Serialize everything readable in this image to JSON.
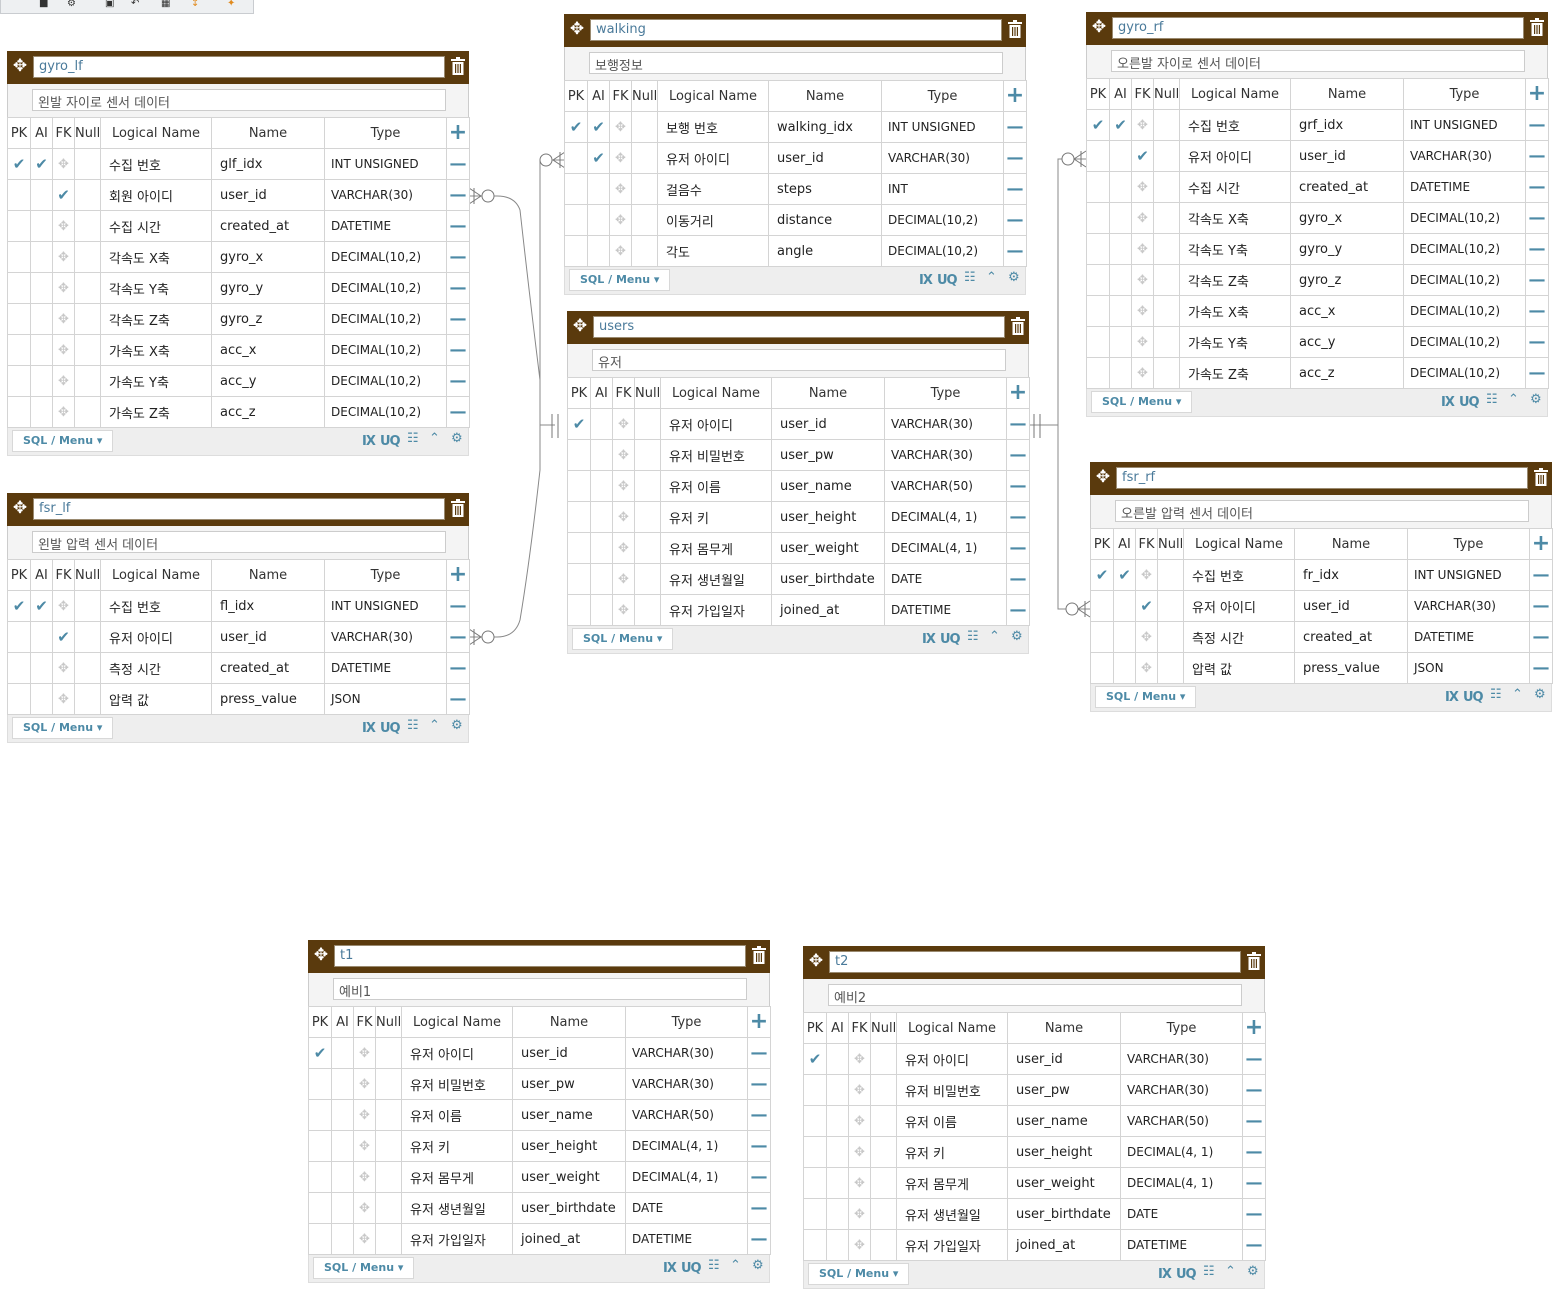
{
  "toolbar": {
    "icons": [
      "save-icon",
      "settings-icon",
      "export-icon",
      "undo-icon",
      "grid-icon",
      "sort-icon",
      "magic-icon"
    ]
  },
  "colors": {
    "header": "#5a3a0d",
    "accent": "#4d8aa6",
    "grid": "#d4d4d4"
  },
  "columns_header": {
    "pk": "PK",
    "ai": "AI",
    "fk": "FK",
    "null": "Null",
    "logical": "Logical Name",
    "name": "Name",
    "type": "Type"
  },
  "footer": {
    "sql_menu": "SQL / Menu",
    "ix": "IX",
    "uq": "UQ"
  },
  "tables": [
    {
      "id": "gyro_lf",
      "name": "gyro_lf",
      "comment": "왼발 자이로 센서 데이터",
      "rows": [
        {
          "pk": true,
          "ai": true,
          "fk": false,
          "logical": "수집 번호",
          "name": "glf_idx",
          "type": "INT UNSIGNED"
        },
        {
          "pk": false,
          "ai": false,
          "fk": true,
          "logical": "회원 아이디",
          "name": "user_id",
          "type": "VARCHAR(30)"
        },
        {
          "pk": false,
          "ai": false,
          "fk": false,
          "logical": "수집 시간",
          "name": "created_at",
          "type": "DATETIME"
        },
        {
          "pk": false,
          "ai": false,
          "fk": false,
          "logical": "각속도 X축",
          "name": "gyro_x",
          "type": "DECIMAL(10,2)"
        },
        {
          "pk": false,
          "ai": false,
          "fk": false,
          "logical": "각속도 Y축",
          "name": "gyro_y",
          "type": "DECIMAL(10,2)"
        },
        {
          "pk": false,
          "ai": false,
          "fk": false,
          "logical": "각속도 Z축",
          "name": "gyro_z",
          "type": "DECIMAL(10,2)"
        },
        {
          "pk": false,
          "ai": false,
          "fk": false,
          "logical": "가속도 X축",
          "name": "acc_x",
          "type": "DECIMAL(10,2)"
        },
        {
          "pk": false,
          "ai": false,
          "fk": false,
          "logical": "가속도 Y축",
          "name": "acc_y",
          "type": "DECIMAL(10,2)"
        },
        {
          "pk": false,
          "ai": false,
          "fk": false,
          "logical": "가속도 Z축",
          "name": "acc_z",
          "type": "DECIMAL(10,2)"
        }
      ]
    },
    {
      "id": "fsr_lf",
      "name": "fsr_lf",
      "comment": "왼발 압력 센서 데이터",
      "rows": [
        {
          "pk": true,
          "ai": true,
          "fk": false,
          "logical": "수집 번호",
          "name": "fl_idx",
          "type": "INT UNSIGNED"
        },
        {
          "pk": false,
          "ai": false,
          "fk": true,
          "logical": "유저 아이디",
          "name": "user_id",
          "type": "VARCHAR(30)"
        },
        {
          "pk": false,
          "ai": false,
          "fk": false,
          "logical": "측정 시간",
          "name": "created_at",
          "type": "DATETIME"
        },
        {
          "pk": false,
          "ai": false,
          "fk": false,
          "logical": "압력 값",
          "name": "press_value",
          "type": "JSON"
        }
      ]
    },
    {
      "id": "walking",
      "name": "walking",
      "comment": "보행정보",
      "rows": [
        {
          "pk": true,
          "ai": true,
          "fk": false,
          "logical": "보행 번호",
          "name": "walking_idx",
          "type": "INT UNSIGNED"
        },
        {
          "pk": false,
          "ai": true,
          "fk": false,
          "logical": "유저 아이디",
          "name": "user_id",
          "type": "VARCHAR(30)"
        },
        {
          "pk": false,
          "ai": false,
          "fk": false,
          "logical": "걸음수",
          "name": "steps",
          "type": "INT"
        },
        {
          "pk": false,
          "ai": false,
          "fk": false,
          "logical": "이동거리",
          "name": "distance",
          "type": "DECIMAL(10,2)"
        },
        {
          "pk": false,
          "ai": false,
          "fk": false,
          "logical": "각도",
          "name": "angle",
          "type": "DECIMAL(10,2)"
        }
      ]
    },
    {
      "id": "users",
      "name": "users",
      "comment": "유저",
      "rows": [
        {
          "pk": true,
          "ai": false,
          "fk": false,
          "logical": "유저 아이디",
          "name": "user_id",
          "type": "VARCHAR(30)"
        },
        {
          "pk": false,
          "ai": false,
          "fk": false,
          "logical": "유저 비밀번호",
          "name": "user_pw",
          "type": "VARCHAR(30)"
        },
        {
          "pk": false,
          "ai": false,
          "fk": false,
          "logical": "유저 이름",
          "name": "user_name",
          "type": "VARCHAR(50)"
        },
        {
          "pk": false,
          "ai": false,
          "fk": false,
          "logical": "유저 키",
          "name": "user_height",
          "type": "DECIMAL(4, 1)"
        },
        {
          "pk": false,
          "ai": false,
          "fk": false,
          "logical": "유저 몸무게",
          "name": "user_weight",
          "type": "DECIMAL(4, 1)"
        },
        {
          "pk": false,
          "ai": false,
          "fk": false,
          "logical": "유저 생년월일",
          "name": "user_birthdate",
          "type": "DATE"
        },
        {
          "pk": false,
          "ai": false,
          "fk": false,
          "logical": "유저 가입일자",
          "name": "joined_at",
          "type": "DATETIME"
        }
      ]
    },
    {
      "id": "gyro_rf",
      "name": "gyro_rf",
      "comment": "오른발 자이로 센서 데이터",
      "rows": [
        {
          "pk": true,
          "ai": true,
          "fk": false,
          "logical": "수집 번호",
          "name": "grf_idx",
          "type": "INT UNSIGNED"
        },
        {
          "pk": false,
          "ai": false,
          "fk": true,
          "logical": "유저 아이디",
          "name": "user_id",
          "type": "VARCHAR(30)"
        },
        {
          "pk": false,
          "ai": false,
          "fk": false,
          "logical": "수집 시간",
          "name": "created_at",
          "type": "DATETIME"
        },
        {
          "pk": false,
          "ai": false,
          "fk": false,
          "logical": "각속도 X축",
          "name": "gyro_x",
          "type": "DECIMAL(10,2)"
        },
        {
          "pk": false,
          "ai": false,
          "fk": false,
          "logical": "각속도 Y축",
          "name": "gyro_y",
          "type": "DECIMAL(10,2)"
        },
        {
          "pk": false,
          "ai": false,
          "fk": false,
          "logical": "각속도 Z축",
          "name": "gyro_z",
          "type": "DECIMAL(10,2)"
        },
        {
          "pk": false,
          "ai": false,
          "fk": false,
          "logical": "가속도 X축",
          "name": "acc_x",
          "type": "DECIMAL(10,2)"
        },
        {
          "pk": false,
          "ai": false,
          "fk": false,
          "logical": "가속도 Y축",
          "name": "acc_y",
          "type": "DECIMAL(10,2)"
        },
        {
          "pk": false,
          "ai": false,
          "fk": false,
          "logical": "가속도 Z축",
          "name": "acc_z",
          "type": "DECIMAL(10,2)"
        }
      ]
    },
    {
      "id": "fsr_rf",
      "name": "fsr_rf",
      "comment": "오른발 압력 센서 데이터",
      "rows": [
        {
          "pk": true,
          "ai": true,
          "fk": false,
          "logical": "수집 번호",
          "name": "fr_idx",
          "type": "INT UNSIGNED"
        },
        {
          "pk": false,
          "ai": false,
          "fk": true,
          "logical": "유저 아이디",
          "name": "user_id",
          "type": "VARCHAR(30)"
        },
        {
          "pk": false,
          "ai": false,
          "fk": false,
          "logical": "측정 시간",
          "name": "created_at",
          "type": "DATETIME"
        },
        {
          "pk": false,
          "ai": false,
          "fk": false,
          "logical": "압력 값",
          "name": "press_value",
          "type": "JSON"
        }
      ]
    },
    {
      "id": "t1",
      "name": "t1",
      "comment": "예비1",
      "rows": [
        {
          "pk": true,
          "ai": false,
          "fk": false,
          "logical": "유저 아이디",
          "name": "user_id",
          "type": "VARCHAR(30)"
        },
        {
          "pk": false,
          "ai": false,
          "fk": false,
          "logical": "유저 비밀번호",
          "name": "user_pw",
          "type": "VARCHAR(30)"
        },
        {
          "pk": false,
          "ai": false,
          "fk": false,
          "logical": "유저 이름",
          "name": "user_name",
          "type": "VARCHAR(50)"
        },
        {
          "pk": false,
          "ai": false,
          "fk": false,
          "logical": "유저 키",
          "name": "user_height",
          "type": "DECIMAL(4, 1)"
        },
        {
          "pk": false,
          "ai": false,
          "fk": false,
          "logical": "유저 몸무게",
          "name": "user_weight",
          "type": "DECIMAL(4, 1)"
        },
        {
          "pk": false,
          "ai": false,
          "fk": false,
          "logical": "유저 생년월일",
          "name": "user_birthdate",
          "type": "DATE"
        },
        {
          "pk": false,
          "ai": false,
          "fk": false,
          "logical": "유저 가입일자",
          "name": "joined_at",
          "type": "DATETIME"
        }
      ]
    },
    {
      "id": "t2",
      "name": "t2",
      "comment": "예비2",
      "rows": [
        {
          "pk": true,
          "ai": false,
          "fk": false,
          "logical": "유저 아이디",
          "name": "user_id",
          "type": "VARCHAR(30)"
        },
        {
          "pk": false,
          "ai": false,
          "fk": false,
          "logical": "유저 비밀번호",
          "name": "user_pw",
          "type": "VARCHAR(30)"
        },
        {
          "pk": false,
          "ai": false,
          "fk": false,
          "logical": "유저 이름",
          "name": "user_name",
          "type": "VARCHAR(50)"
        },
        {
          "pk": false,
          "ai": false,
          "fk": false,
          "logical": "유저 키",
          "name": "user_height",
          "type": "DECIMAL(4, 1)"
        },
        {
          "pk": false,
          "ai": false,
          "fk": false,
          "logical": "유저 몸무게",
          "name": "user_weight",
          "type": "DECIMAL(4, 1)"
        },
        {
          "pk": false,
          "ai": false,
          "fk": false,
          "logical": "유저 생년월일",
          "name": "user_birthdate",
          "type": "DATE"
        },
        {
          "pk": false,
          "ai": false,
          "fk": false,
          "logical": "유저 가입일자",
          "name": "joined_at",
          "type": "DATETIME"
        }
      ]
    }
  ],
  "relationships": [
    {
      "from": "users",
      "to": "gyro_lf"
    },
    {
      "from": "users",
      "to": "fsr_lf"
    },
    {
      "from": "users",
      "to": "walking"
    },
    {
      "from": "users",
      "to": "gyro_rf"
    },
    {
      "from": "users",
      "to": "fsr_rf"
    }
  ]
}
